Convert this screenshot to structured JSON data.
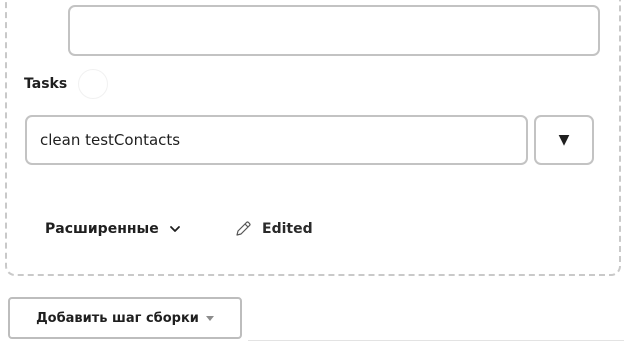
{
  "tasks_section": {
    "label": "Tasks",
    "task_value": "clean testContacts",
    "dropdown_glyph": "▼"
  },
  "advanced": {
    "label": "Расширенные",
    "chevron_icon": "chevron-down-icon"
  },
  "edited": {
    "label": "Edited",
    "icon": "pencil-icon"
  },
  "add_step": {
    "label": "Добавить шаг сборки",
    "icon": "caret-down-icon"
  }
}
